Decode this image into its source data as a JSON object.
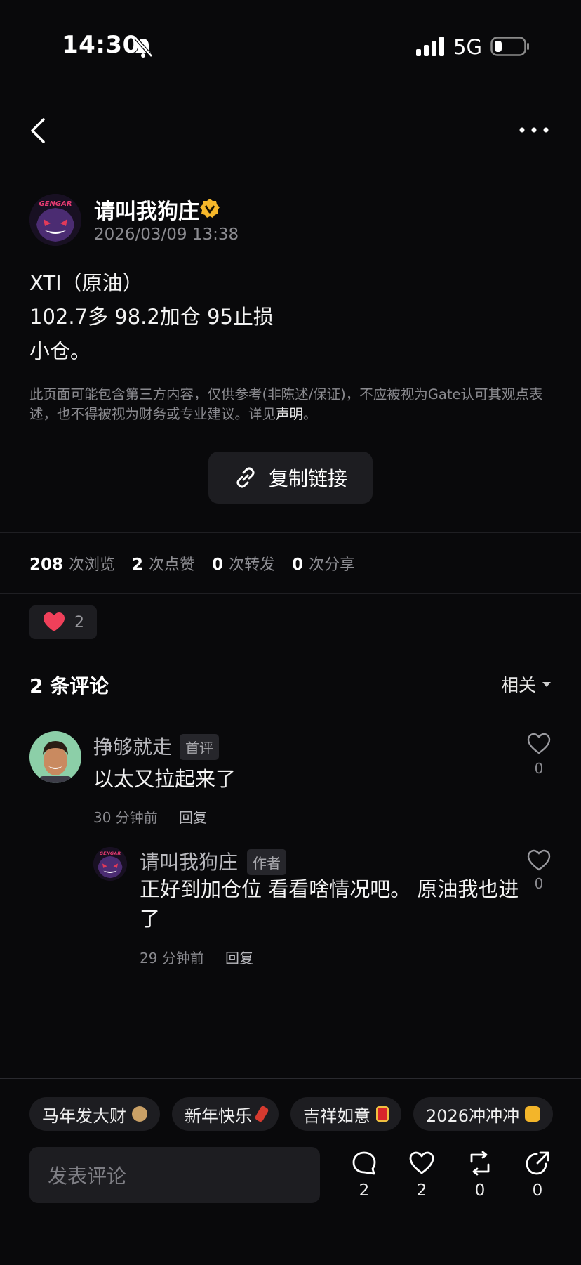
{
  "status_bar": {
    "time": "14:30",
    "network": "5G"
  },
  "post": {
    "author": "请叫我狗庄",
    "date": "2026/03/09 13:38",
    "lines": [
      "XTI（原油）",
      "102.7多 98.2加仓 95止损",
      "小仓。"
    ],
    "disclaimer_text": "此页面可能包含第三方内容，仅供参考(非陈述/保证)，不应被视为Gate认可其观点表述，也不得被视为财务或专业建议。详见",
    "disclaimer_link": "声明",
    "disclaimer_end": "。",
    "copy_link_label": "复制链接"
  },
  "stats": {
    "views": "208",
    "views_label": "次浏览",
    "likes": "2",
    "likes_label": "次点赞",
    "reposts": "0",
    "reposts_label": "次转发",
    "shares": "0",
    "shares_label": "次分享"
  },
  "reaction": {
    "heart_count": "2"
  },
  "comments_header": {
    "title": "2 条评论",
    "sort": "相关"
  },
  "comments": [
    {
      "user": "挣够就走",
      "tag": "首评",
      "text": "以太又拉起来了",
      "time": "30 分钟前",
      "reply": "回复",
      "likes": "0"
    },
    {
      "user": "请叫我狗庄",
      "tag": "作者",
      "text_line1": "正好到加仓位 看看啥情况吧。 原油我也进",
      "text_line2": "了",
      "time": "29 分钟前",
      "reply": "回复",
      "likes": "0"
    }
  ],
  "quick_chips": [
    {
      "label": "马年发大财",
      "emoji_icon": "horse-icon",
      "color": "#c9a066"
    },
    {
      "label": "新年快乐",
      "emoji_icon": "firecracker-icon",
      "color": "#d63a2f"
    },
    {
      "label": "吉祥如意",
      "emoji_icon": "red-envelope-icon",
      "color": "#d8262b"
    },
    {
      "label": "2026冲冲冲",
      "emoji_icon": "fist-icon",
      "color": "#f3b52a"
    }
  ],
  "composer": {
    "placeholder": "发表评论"
  },
  "actions": {
    "comments": "2",
    "likes": "2",
    "reposts": "0",
    "shares": "0"
  },
  "colors": {
    "background": "#09090b",
    "surface": "#1d1d21",
    "heart": "#f0405a",
    "verified": "#f5b72a"
  }
}
